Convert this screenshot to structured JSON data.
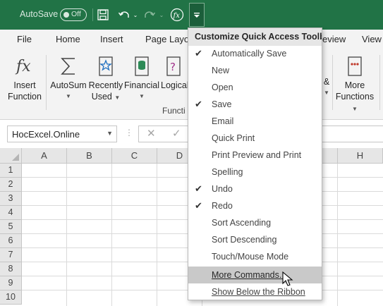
{
  "titlebar": {
    "autosave_label": "AutoSave",
    "autosave_state": "Off",
    "accent_color": "#217346"
  },
  "tabs": [
    "File",
    "Home",
    "Insert",
    "Page Layo",
    "eview",
    "View"
  ],
  "ribbon": {
    "buttons": [
      {
        "line1": "Insert",
        "line2": "Function",
        "icon": "fx-icon"
      },
      {
        "line1": "AutoSum",
        "line2": "",
        "icon": "sigma-icon"
      },
      {
        "line1": "Recently",
        "line2": "Used",
        "icon": "star-book-icon"
      },
      {
        "line1": "Financial",
        "line2": "",
        "icon": "database-book-icon"
      },
      {
        "line1": "Logical",
        "line2": "",
        "icon": "question-book-icon"
      },
      {
        "line1": "&",
        "line2": "",
        "icon": "partial-icon"
      },
      {
        "line1": "More",
        "line2": "Functions",
        "icon": "more-book-icon"
      }
    ],
    "group_label": "Functi"
  },
  "formula_bar": {
    "name_box": "HocExcel.Online"
  },
  "grid": {
    "columns": [
      "A",
      "B",
      "C",
      "D",
      "H"
    ],
    "rows": [
      "1",
      "2",
      "3",
      "4",
      "5",
      "6",
      "7",
      "8",
      "9",
      "10"
    ]
  },
  "menu": {
    "title": "Customize Quick Access Toolbar",
    "items": [
      {
        "label": "Automatically Save",
        "checked": true
      },
      {
        "label": "New",
        "checked": false
      },
      {
        "label": "Open",
        "checked": false
      },
      {
        "label": "Save",
        "checked": true
      },
      {
        "label": "Email",
        "checked": false
      },
      {
        "label": "Quick Print",
        "checked": false
      },
      {
        "label": "Print Preview and Print",
        "checked": false
      },
      {
        "label": "Spelling",
        "checked": false
      },
      {
        "label": "Undo",
        "checked": true
      },
      {
        "label": "Redo",
        "checked": true
      },
      {
        "label": "Sort Ascending",
        "checked": false
      },
      {
        "label": "Sort Descending",
        "checked": false
      },
      {
        "label": "Touch/Mouse Mode",
        "checked": false
      },
      {
        "label": "More Commands...",
        "checked": false,
        "highlighted": true
      },
      {
        "label": "Show Below the Ribbon",
        "checked": false
      }
    ],
    "check_glyph": "✔"
  }
}
